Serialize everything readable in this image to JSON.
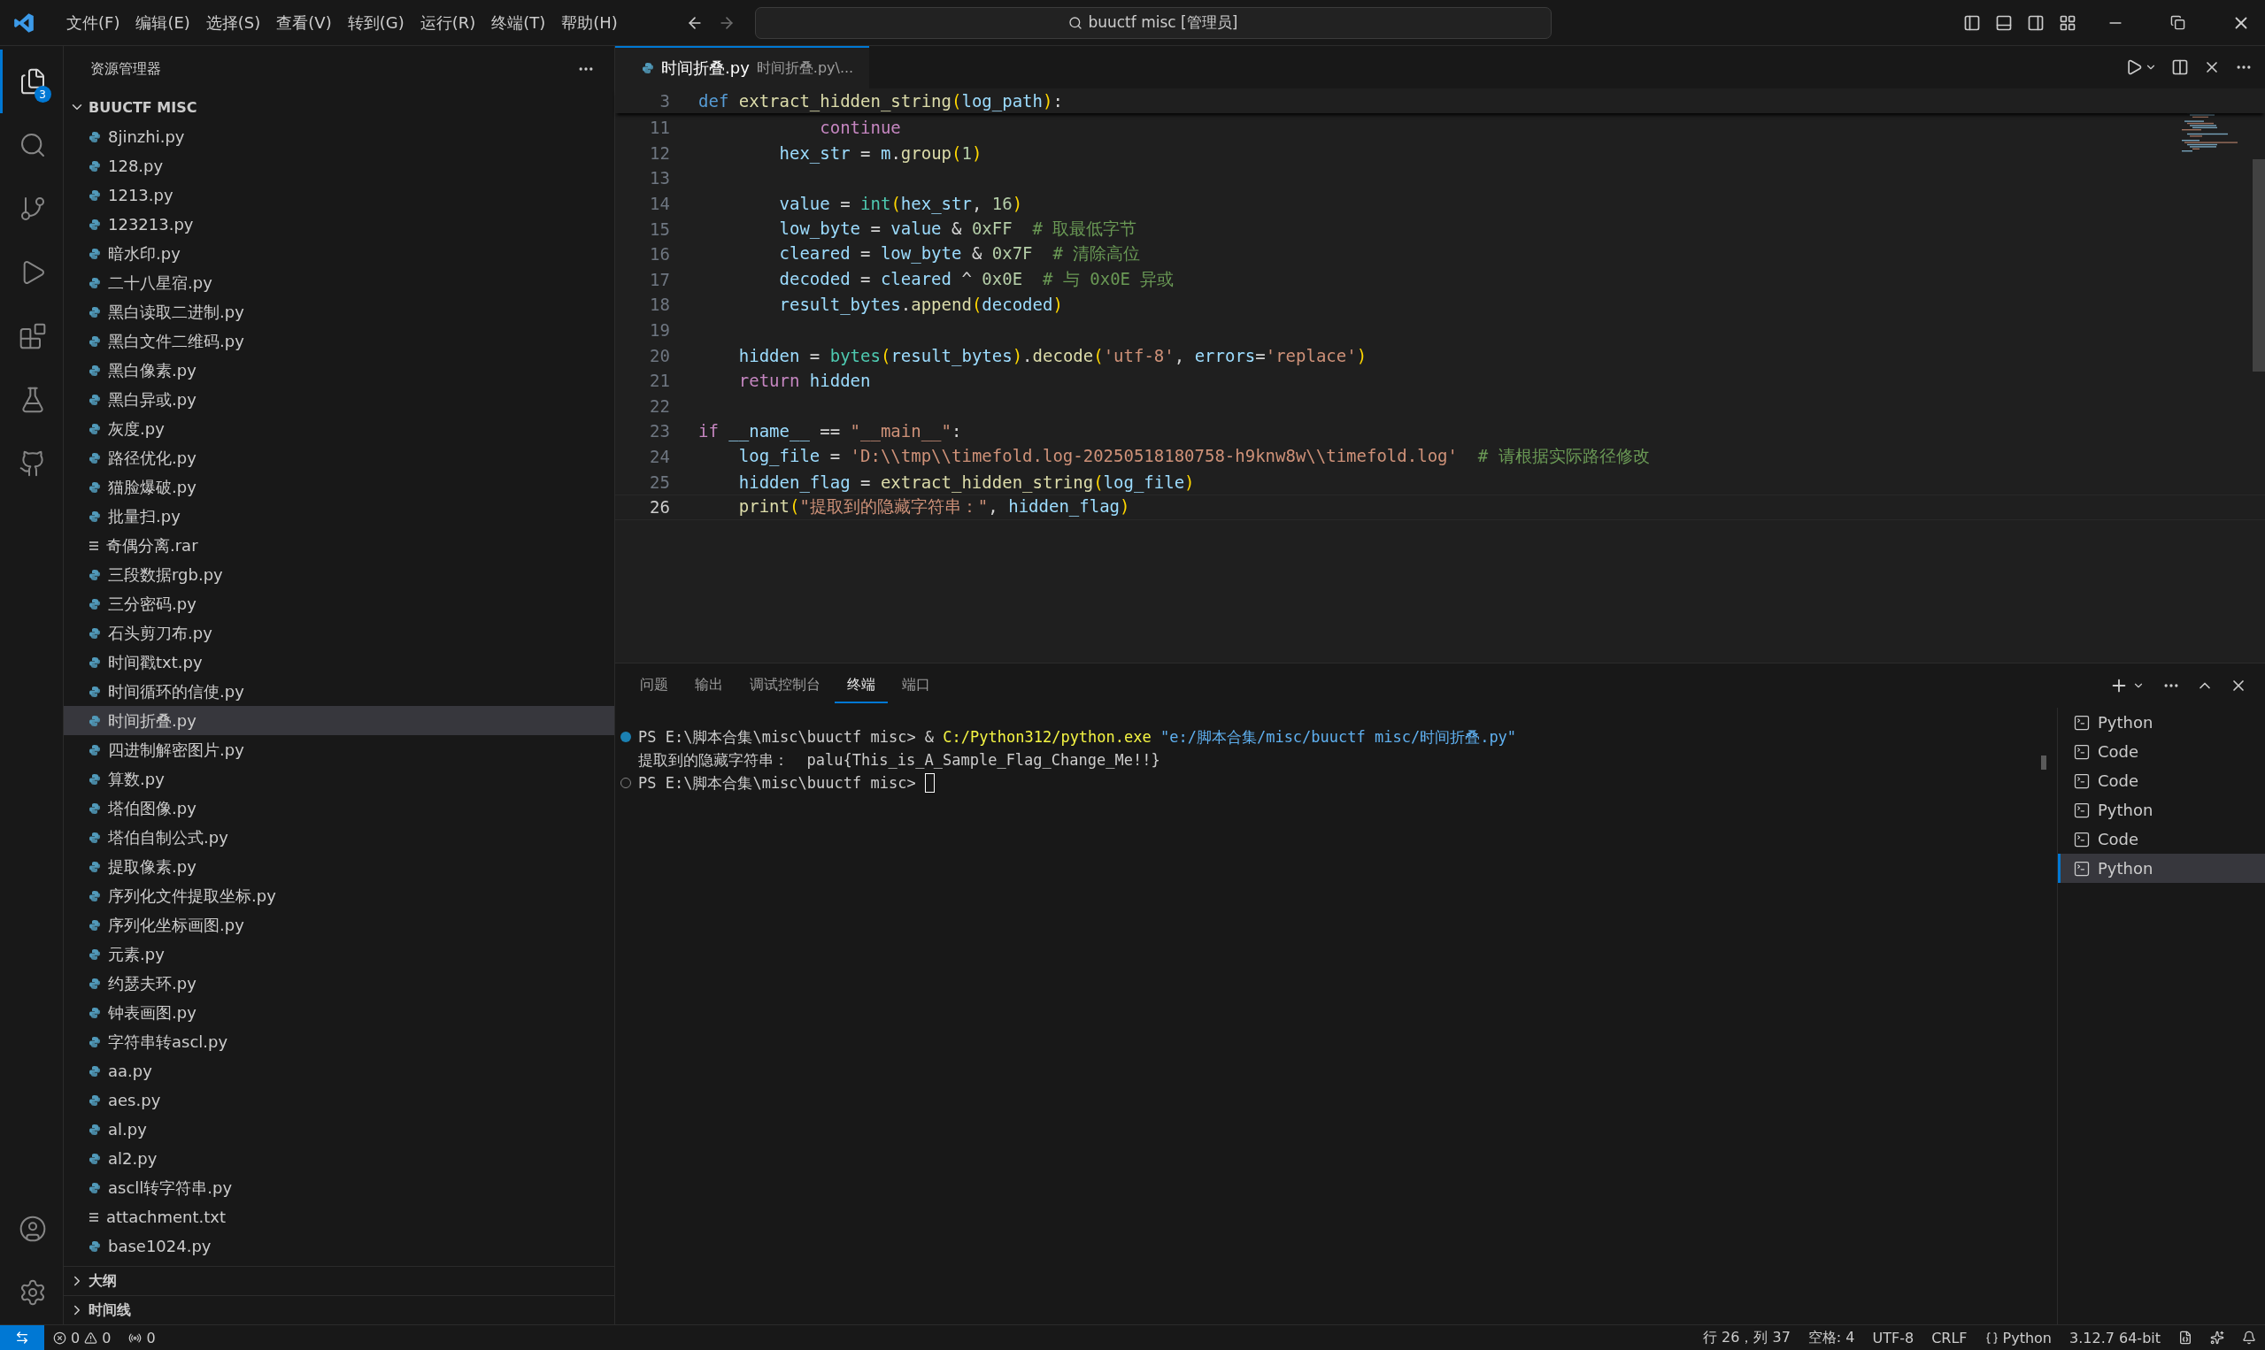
{
  "title_bar": {
    "menus": [
      "文件(F)",
      "编辑(E)",
      "选择(S)",
      "查看(V)",
      "转到(G)",
      "运行(R)",
      "终端(T)",
      "帮助(H)"
    ],
    "command_center": "buuctf misc [管理员]"
  },
  "activity_bar": {
    "items": [
      {
        "kind": "explorer",
        "selected": true,
        "badge": "3"
      },
      {
        "kind": "search",
        "selected": false
      },
      {
        "kind": "source-control",
        "selected": false
      },
      {
        "kind": "run",
        "selected": false
      },
      {
        "kind": "extensions",
        "selected": false
      },
      {
        "kind": "testing",
        "selected": false
      },
      {
        "kind": "remote",
        "selected": false
      }
    ]
  },
  "sidebar": {
    "title": "资源管理器",
    "folder": "BUUCTF MISC",
    "files": [
      {
        "name": "8jinzhi.py",
        "kind": "py",
        "selected": false
      },
      {
        "name": "128.py",
        "kind": "py",
        "selected": false
      },
      {
        "name": "1213.py",
        "kind": "py",
        "selected": false
      },
      {
        "name": "123213.py",
        "kind": "py",
        "selected": false
      },
      {
        "name": "暗水印.py",
        "kind": "py",
        "selected": false
      },
      {
        "name": "二十八星宿.py",
        "kind": "py",
        "selected": false
      },
      {
        "name": "黑白读取二进制.py",
        "kind": "py",
        "selected": false
      },
      {
        "name": "黑白文件二维码.py",
        "kind": "py",
        "selected": false
      },
      {
        "name": "黑白像素.py",
        "kind": "py",
        "selected": false
      },
      {
        "name": "黑白异或.py",
        "kind": "py",
        "selected": false
      },
      {
        "name": "灰度.py",
        "kind": "py",
        "selected": false
      },
      {
        "name": "路径优化.py",
        "kind": "py",
        "selected": false
      },
      {
        "name": "猫脸爆破.py",
        "kind": "py",
        "selected": false
      },
      {
        "name": "批量扫.py",
        "kind": "py",
        "selected": false
      },
      {
        "name": "奇偶分离.rar",
        "kind": "text",
        "selected": false
      },
      {
        "name": "三段数据rgb.py",
        "kind": "py",
        "selected": false
      },
      {
        "name": "三分密码.py",
        "kind": "py",
        "selected": false
      },
      {
        "name": "石头剪刀布.py",
        "kind": "py",
        "selected": false
      },
      {
        "name": "时间戳txt.py",
        "kind": "py",
        "selected": false
      },
      {
        "name": "时间循环的信使.py",
        "kind": "py",
        "selected": false
      },
      {
        "name": "时间折叠.py",
        "kind": "py",
        "selected": true
      },
      {
        "name": "四进制解密图片.py",
        "kind": "py",
        "selected": false
      },
      {
        "name": "算数.py",
        "kind": "py",
        "selected": false
      },
      {
        "name": "塔伯图像.py",
        "kind": "py",
        "selected": false
      },
      {
        "name": "塔伯自制公式.py",
        "kind": "py",
        "selected": false
      },
      {
        "name": "提取像素.py",
        "kind": "py",
        "selected": false
      },
      {
        "name": "序列化文件提取坐标.py",
        "kind": "py",
        "selected": false
      },
      {
        "name": "序列化坐标画图.py",
        "kind": "py",
        "selected": false
      },
      {
        "name": "元素.py",
        "kind": "py",
        "selected": false
      },
      {
        "name": "约瑟夫环.py",
        "kind": "py",
        "selected": false
      },
      {
        "name": "钟表画图.py",
        "kind": "py",
        "selected": false
      },
      {
        "name": "字符串转ascl.py",
        "kind": "py",
        "selected": false
      },
      {
        "name": "aa.py",
        "kind": "py",
        "selected": false
      },
      {
        "name": "aes.py",
        "kind": "py",
        "selected": false
      },
      {
        "name": "al.py",
        "kind": "py",
        "selected": false
      },
      {
        "name": "al2.py",
        "kind": "py",
        "selected": false
      },
      {
        "name": "ascll转字符串.py",
        "kind": "py",
        "selected": false
      },
      {
        "name": "attachment.txt",
        "kind": "text",
        "selected": false
      },
      {
        "name": "base1024.py",
        "kind": "py",
        "selected": false
      }
    ],
    "sections": [
      {
        "label": "大纲",
        "expanded": false
      },
      {
        "label": "时间线",
        "expanded": false
      }
    ]
  },
  "editor": {
    "tab": {
      "name": "时间折叠.py",
      "description": "时间折叠.py\\..."
    },
    "sticky_line": {
      "number": "3",
      "tokens": [
        {
          "kind": "keyword",
          "text": "def "
        },
        {
          "kind": "function",
          "text": "extract_hidden_string"
        },
        {
          "kind": "bracket",
          "text": "("
        },
        {
          "kind": "variable",
          "text": "log_path"
        },
        {
          "kind": "bracket",
          "text": ")"
        },
        {
          "kind": "plain",
          "text": ":"
        }
      ]
    },
    "lines": [
      {
        "number": "11",
        "current": false,
        "tokens": [
          {
            "kind": "control",
            "text": "            continue"
          }
        ]
      },
      {
        "number": "12",
        "current": false,
        "tokens": [
          {
            "kind": "variable",
            "text": "        hex_str"
          },
          {
            "kind": "plain",
            "text": " = "
          },
          {
            "kind": "variable",
            "text": "m"
          },
          {
            "kind": "plain",
            "text": "."
          },
          {
            "kind": "function",
            "text": "group"
          },
          {
            "kind": "bracket",
            "text": "("
          },
          {
            "kind": "number",
            "text": "1"
          },
          {
            "kind": "bracket",
            "text": ")"
          }
        ]
      },
      {
        "number": "13",
        "current": false
      },
      {
        "number": "14",
        "current": false,
        "tokens": [
          {
            "kind": "variable",
            "text": "        value"
          },
          {
            "kind": "plain",
            "text": " = "
          },
          {
            "kind": "class",
            "text": "int"
          },
          {
            "kind": "bracket",
            "text": "("
          },
          {
            "kind": "variable",
            "text": "hex_str"
          },
          {
            "kind": "plain",
            "text": ", "
          },
          {
            "kind": "number",
            "text": "16"
          },
          {
            "kind": "bracket",
            "text": ")"
          }
        ]
      },
      {
        "number": "15",
        "current": false,
        "tokens": [
          {
            "kind": "variable",
            "text": "        low_byte"
          },
          {
            "kind": "plain",
            "text": " = "
          },
          {
            "kind": "variable",
            "text": "value"
          },
          {
            "kind": "plain",
            "text": " & "
          },
          {
            "kind": "number",
            "text": "0xFF"
          },
          {
            "kind": "comment",
            "text": "  # 取最低字节"
          }
        ]
      },
      {
        "number": "16",
        "current": false,
        "tokens": [
          {
            "kind": "variable",
            "text": "        cleared"
          },
          {
            "kind": "plain",
            "text": " = "
          },
          {
            "kind": "variable",
            "text": "low_byte"
          },
          {
            "kind": "plain",
            "text": " & "
          },
          {
            "kind": "number",
            "text": "0x7F"
          },
          {
            "kind": "comment",
            "text": "  # 清除高位"
          }
        ]
      },
      {
        "number": "17",
        "current": false,
        "tokens": [
          {
            "kind": "variable",
            "text": "        decoded"
          },
          {
            "kind": "plain",
            "text": " = "
          },
          {
            "kind": "variable",
            "text": "cleared"
          },
          {
            "kind": "plain",
            "text": " ^ "
          },
          {
            "kind": "number",
            "text": "0x0E"
          },
          {
            "kind": "comment",
            "text": "  # 与 0x0E 异或"
          }
        ]
      },
      {
        "number": "18",
        "current": false,
        "tokens": [
          {
            "kind": "variable",
            "text": "        result_bytes"
          },
          {
            "kind": "plain",
            "text": "."
          },
          {
            "kind": "function",
            "text": "append"
          },
          {
            "kind": "bracket",
            "text": "("
          },
          {
            "kind": "variable",
            "text": "decoded"
          },
          {
            "kind": "bracket",
            "text": ")"
          }
        ]
      },
      {
        "number": "19",
        "current": false
      },
      {
        "number": "20",
        "current": false,
        "tokens": [
          {
            "kind": "variable",
            "text": "    hidden"
          },
          {
            "kind": "plain",
            "text": " = "
          },
          {
            "kind": "class",
            "text": "bytes"
          },
          {
            "kind": "bracket",
            "text": "("
          },
          {
            "kind": "variable",
            "text": "result_bytes"
          },
          {
            "kind": "bracket",
            "text": ")"
          },
          {
            "kind": "plain",
            "text": "."
          },
          {
            "kind": "function",
            "text": "decode"
          },
          {
            "kind": "bracket",
            "text": "("
          },
          {
            "kind": "string",
            "text": "'utf-8'"
          },
          {
            "kind": "plain",
            "text": ", "
          },
          {
            "kind": "variable",
            "text": "errors"
          },
          {
            "kind": "plain",
            "text": "="
          },
          {
            "kind": "string",
            "text": "'replace'"
          },
          {
            "kind": "bracket",
            "text": ")"
          }
        ]
      },
      {
        "number": "21",
        "current": false,
        "tokens": [
          {
            "kind": "control",
            "text": "    return "
          },
          {
            "kind": "variable",
            "text": "hidden"
          }
        ]
      },
      {
        "number": "22",
        "current": false
      },
      {
        "number": "23",
        "current": false,
        "tokens": [
          {
            "kind": "control",
            "text": "if "
          },
          {
            "kind": "variable",
            "text": "__name__"
          },
          {
            "kind": "plain",
            "text": " == "
          },
          {
            "kind": "string",
            "text": "\"__main__\""
          },
          {
            "kind": "plain",
            "text": ":"
          }
        ]
      },
      {
        "number": "24",
        "current": false,
        "tokens": [
          {
            "kind": "variable",
            "text": "    log_file"
          },
          {
            "kind": "plain",
            "text": " = "
          },
          {
            "kind": "string",
            "text": "'D:\\\\tmp\\\\timefold.log-20250518180758-h9knw8w\\\\timefold.log'"
          },
          {
            "kind": "comment",
            "text": "  # 请根据实际路径修改"
          }
        ]
      },
      {
        "number": "25",
        "current": false,
        "tokens": [
          {
            "kind": "variable",
            "text": "    hidden_flag"
          },
          {
            "kind": "plain",
            "text": " = "
          },
          {
            "kind": "function",
            "text": "extract_hidden_string"
          },
          {
            "kind": "bracket",
            "text": "("
          },
          {
            "kind": "variable",
            "text": "log_file"
          },
          {
            "kind": "bracket",
            "text": ")"
          }
        ]
      },
      {
        "number": "26",
        "current": true,
        "tokens": [
          {
            "kind": "function",
            "text": "    print"
          },
          {
            "kind": "bracket",
            "text": "("
          },
          {
            "kind": "string",
            "text": "\"提取到的隐藏字符串：\""
          },
          {
            "kind": "plain",
            "text": ", "
          },
          {
            "kind": "variable",
            "text": "hidden_flag"
          },
          {
            "kind": "bracket",
            "text": ")"
          }
        ]
      }
    ]
  },
  "panel": {
    "tabs": [
      {
        "label": "问题",
        "selected": false
      },
      {
        "label": "输出",
        "selected": false
      },
      {
        "label": "调试控制台",
        "selected": false
      },
      {
        "label": "终端",
        "selected": true
      },
      {
        "label": "端口",
        "selected": false
      }
    ],
    "terminal_lines": [
      {
        "kind": "command",
        "finished": true,
        "tokens": [
          {
            "kind": "plain",
            "text": "PS E:\\脚本合集\\misc\\buuctf misc> & "
          },
          {
            "kind": "command",
            "text": "C:/Python312/python.exe"
          },
          {
            "kind": "string",
            "text": " \"e:/脚本合集/misc/buuctf misc/时间折叠.py\""
          }
        ]
      },
      {
        "kind": "output",
        "tokens": [
          {
            "kind": "plain",
            "text": "提取到的隐藏字符串：  palu{This_is_A_Sample_Flag_Change_Me!!}"
          }
        ]
      },
      {
        "kind": "command",
        "finished": false,
        "cursor": true,
        "tokens": [
          {
            "kind": "plain",
            "text": "PS E:\\脚本合集\\misc\\buuctf misc> "
          }
        ]
      }
    ],
    "terminals": [
      {
        "name": "Python",
        "selected": false
      },
      {
        "name": "Code",
        "selected": false
      },
      {
        "name": "Code",
        "selected": false
      },
      {
        "name": "Python",
        "selected": false
      },
      {
        "name": "Code",
        "selected": false
      },
      {
        "name": "Python",
        "selected": true
      }
    ]
  },
  "status_bar": {
    "errors": "0",
    "warnings": "0",
    "ports": "0",
    "position": "行 26，列 37",
    "indent": "空格: 4",
    "encoding": "UTF-8",
    "eol": "CRLF",
    "language": "Python",
    "interpreter": "3.12.7 64-bit"
  }
}
